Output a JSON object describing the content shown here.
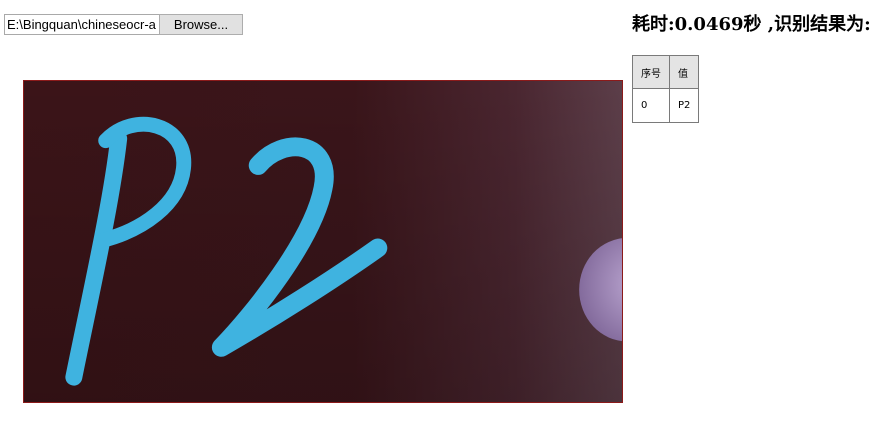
{
  "file_input": {
    "path_value": "E:\\Bingquan\\chineseocr-a",
    "browse_label": "Browse..."
  },
  "result": {
    "title": "耗时:0.0469秒 ,识别结果为:",
    "columns": [
      "序号",
      "值"
    ],
    "rows": [
      {
        "index": "0",
        "value": "P2"
      }
    ]
  },
  "colors": {
    "image_border": "#8c1a1a",
    "image_background": "#3a1216",
    "ink": "#3fb3e0"
  }
}
